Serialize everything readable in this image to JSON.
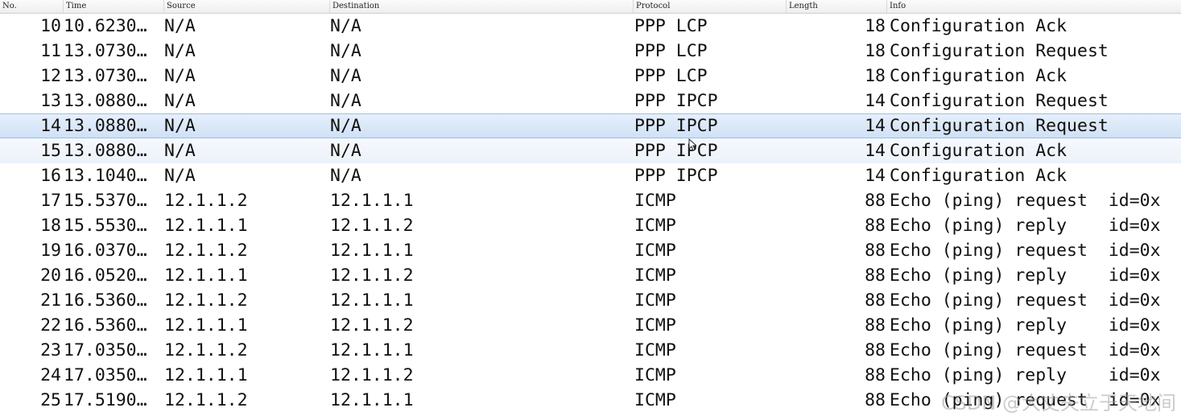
{
  "columns": {
    "no": "No.",
    "time": "Time",
    "source": "Source",
    "destination": "Destination",
    "protocol": "Protocol",
    "length": "Length",
    "info": "Info"
  },
  "selected_row_index": 4,
  "hover_row_index": 5,
  "packets": [
    {
      "no": "10",
      "time": "10.6230…",
      "source": "N/A",
      "destination": "N/A",
      "protocol": "PPP LCP",
      "length": "18",
      "info": "Configuration Ack"
    },
    {
      "no": "11",
      "time": "13.0730…",
      "source": "N/A",
      "destination": "N/A",
      "protocol": "PPP LCP",
      "length": "18",
      "info": "Configuration Request"
    },
    {
      "no": "12",
      "time": "13.0730…",
      "source": "N/A",
      "destination": "N/A",
      "protocol": "PPP LCP",
      "length": "18",
      "info": "Configuration Ack"
    },
    {
      "no": "13",
      "time": "13.0880…",
      "source": "N/A",
      "destination": "N/A",
      "protocol": "PPP IPCP",
      "length": "14",
      "info": "Configuration Request"
    },
    {
      "no": "14",
      "time": "13.0880…",
      "source": "N/A",
      "destination": "N/A",
      "protocol": "PPP IPCP",
      "length": "14",
      "info": "Configuration Request"
    },
    {
      "no": "15",
      "time": "13.0880…",
      "source": "N/A",
      "destination": "N/A",
      "protocol": "PPP IPCP",
      "length": "14",
      "info": "Configuration Ack"
    },
    {
      "no": "16",
      "time": "13.1040…",
      "source": "N/A",
      "destination": "N/A",
      "protocol": "PPP IPCP",
      "length": "14",
      "info": "Configuration Ack"
    },
    {
      "no": "17",
      "time": "15.5370…",
      "source": "12.1.1.2",
      "destination": "12.1.1.1",
      "protocol": "ICMP",
      "length": "88",
      "info": "Echo (ping) request  id=0x"
    },
    {
      "no": "18",
      "time": "15.5530…",
      "source": "12.1.1.1",
      "destination": "12.1.1.2",
      "protocol": "ICMP",
      "length": "88",
      "info": "Echo (ping) reply    id=0x"
    },
    {
      "no": "19",
      "time": "16.0370…",
      "source": "12.1.1.2",
      "destination": "12.1.1.1",
      "protocol": "ICMP",
      "length": "88",
      "info": "Echo (ping) request  id=0x"
    },
    {
      "no": "20",
      "time": "16.0520…",
      "source": "12.1.1.1",
      "destination": "12.1.1.2",
      "protocol": "ICMP",
      "length": "88",
      "info": "Echo (ping) reply    id=0x"
    },
    {
      "no": "21",
      "time": "16.5360…",
      "source": "12.1.1.2",
      "destination": "12.1.1.1",
      "protocol": "ICMP",
      "length": "88",
      "info": "Echo (ping) request  id=0x"
    },
    {
      "no": "22",
      "time": "16.5360…",
      "source": "12.1.1.1",
      "destination": "12.1.1.2",
      "protocol": "ICMP",
      "length": "88",
      "info": "Echo (ping) reply    id=0x"
    },
    {
      "no": "23",
      "time": "17.0350…",
      "source": "12.1.1.2",
      "destination": "12.1.1.1",
      "protocol": "ICMP",
      "length": "88",
      "info": "Echo (ping) request  id=0x"
    },
    {
      "no": "24",
      "time": "17.0350…",
      "source": "12.1.1.1",
      "destination": "12.1.1.2",
      "protocol": "ICMP",
      "length": "88",
      "info": "Echo (ping) reply    id=0x"
    },
    {
      "no": "25",
      "time": "17.5190…",
      "source": "12.1.1.2",
      "destination": "12.1.1.1",
      "protocol": "ICMP",
      "length": "88",
      "info": "Echo (ping) request  id=0x"
    }
  ],
  "watermark": "CSDN @大丈夫立于天地间"
}
